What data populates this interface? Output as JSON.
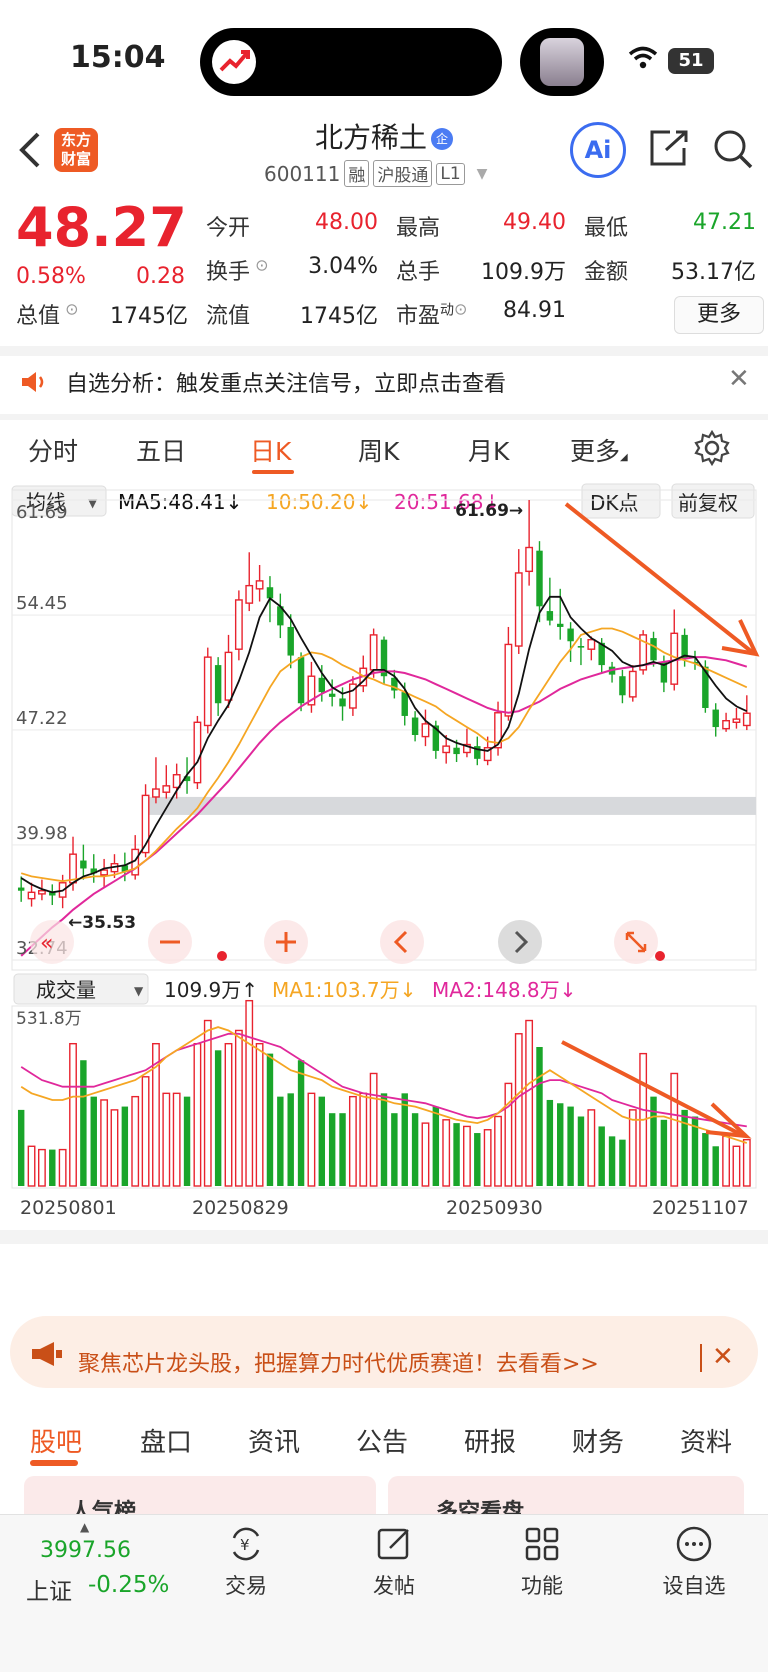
{
  "status": {
    "time": "15:04",
    "battery": "51"
  },
  "header": {
    "logo": "东方财富",
    "title": "北方稀土",
    "title_badge": "企",
    "code": "600111",
    "tags": [
      "融",
      "沪股通",
      "L1"
    ],
    "ai": "Ai"
  },
  "quote": {
    "price": "48.27",
    "change_pct": "0.58%",
    "change": "0.28",
    "fields": [
      {
        "label": "今开",
        "value": "48.00",
        "color": "red"
      },
      {
        "label": "最高",
        "value": "49.40",
        "color": "red"
      },
      {
        "label": "最低",
        "value": "47.21",
        "color": "green"
      },
      {
        "label": "换手",
        "value": "3.04%",
        "color": "dark"
      },
      {
        "label": "总手",
        "value": "109.9万",
        "color": "dark"
      },
      {
        "label": "金额",
        "value": "53.17亿",
        "color": "dark"
      },
      {
        "label": "总值",
        "value": "1745亿",
        "color": "dark"
      },
      {
        "label": "流值",
        "value": "1745亿",
        "color": "dark"
      },
      {
        "label": "市盈",
        "value": "84.91",
        "color": "dark"
      }
    ],
    "pe_sup": "动",
    "more": "更多"
  },
  "notice": {
    "text": "自选分析：触发重点关注信号，立即点击查看"
  },
  "chart_tabs": [
    "分时",
    "五日",
    "日K",
    "周K",
    "月K",
    "更多"
  ],
  "chart_tabs_active": 2,
  "kline": {
    "indicator_select": "均线",
    "ma5": "MA5:48.41↓",
    "ma10": "10:50.20↓",
    "ma20": "20:51.68↓",
    "dk_label": "DK点",
    "fq_label": "前复权",
    "y_labels": [
      "61.69",
      "54.45",
      "47.22",
      "39.98",
      "32.74"
    ],
    "high_marker": "61.69→",
    "low_marker": "←35.53"
  },
  "volume": {
    "select": "成交量",
    "value": "109.9万↑",
    "ma1": "MA1:103.7万↓",
    "ma2": "MA2:148.8万↓",
    "y_top": "531.8万",
    "dates": [
      "20250801",
      "20250829",
      "20250930",
      "20251107"
    ]
  },
  "chart_data": {
    "type": "candlestick",
    "y_range": [
      32.74,
      61.69
    ],
    "candles": [
      [
        37.3,
        37.1,
        38.0,
        36.4
      ],
      [
        36.6,
        37.0,
        37.6,
        36.1
      ],
      [
        36.9,
        37.1,
        37.8,
        36.5
      ],
      [
        37.0,
        36.8,
        37.5,
        36.2
      ],
      [
        36.7,
        37.6,
        38.1,
        36.0
      ],
      [
        37.6,
        39.4,
        40.5,
        37.1
      ],
      [
        39.0,
        38.5,
        40.0,
        37.8
      ],
      [
        38.5,
        38.2,
        39.4,
        37.6
      ],
      [
        38.1,
        38.4,
        39.1,
        37.3
      ],
      [
        38.3,
        38.8,
        39.4,
        37.9
      ],
      [
        38.7,
        38.3,
        39.5,
        37.7
      ],
      [
        38.1,
        39.7,
        40.6,
        37.8
      ],
      [
        39.5,
        43.1,
        43.8,
        39.2
      ],
      [
        43.0,
        43.5,
        45.5,
        42.6
      ],
      [
        43.3,
        43.7,
        45.0,
        42.9
      ],
      [
        43.6,
        44.4,
        45.1,
        42.9
      ],
      [
        44.3,
        44.0,
        45.5,
        43.2
      ],
      [
        43.9,
        47.7,
        48.1,
        43.5
      ],
      [
        47.5,
        51.8,
        52.4,
        47.0
      ],
      [
        51.3,
        48.9,
        51.8,
        48.1
      ],
      [
        49.1,
        52.1,
        53.2,
        48.6
      ],
      [
        52.3,
        55.4,
        56.0,
        51.6
      ],
      [
        55.2,
        56.3,
        58.4,
        54.7
      ],
      [
        56.1,
        56.6,
        57.6,
        55.3
      ],
      [
        56.2,
        55.5,
        56.9,
        54.0
      ],
      [
        55.0,
        53.8,
        55.8,
        53.0
      ],
      [
        53.7,
        51.9,
        54.5,
        51.1
      ],
      [
        51.8,
        48.9,
        52.1,
        48.4
      ],
      [
        48.8,
        50.6,
        51.5,
        48.3
      ],
      [
        50.5,
        49.6,
        51.3,
        49.0
      ],
      [
        49.5,
        49.3,
        50.4,
        48.7
      ],
      [
        49.2,
        48.7,
        49.9,
        47.8
      ],
      [
        48.6,
        50.1,
        50.6,
        48.1
      ],
      [
        50.0,
        51.1,
        51.9,
        49.6
      ],
      [
        51.0,
        53.2,
        53.6,
        50.5
      ],
      [
        52.9,
        50.6,
        53.1,
        50.1
      ],
      [
        50.5,
        49.7,
        51.0,
        49.2
      ],
      [
        49.6,
        48.1,
        50.2,
        47.5
      ],
      [
        48.0,
        46.9,
        48.4,
        46.5
      ],
      [
        46.8,
        47.6,
        48.5,
        46.2
      ],
      [
        47.5,
        45.9,
        47.8,
        45.4
      ],
      [
        45.8,
        46.2,
        46.9,
        45.1
      ],
      [
        46.1,
        45.7,
        46.6,
        45.2
      ],
      [
        45.8,
        46.3,
        47.3,
        45.5
      ],
      [
        46.2,
        45.4,
        46.8,
        45.0
      ],
      [
        45.3,
        46.1,
        46.8,
        45.0
      ],
      [
        46.1,
        48.3,
        49.0,
        45.6
      ],
      [
        48.1,
        52.6,
        53.7,
        47.8
      ],
      [
        52.5,
        57.1,
        58.6,
        52.0
      ],
      [
        57.2,
        58.7,
        61.69,
        56.3
      ],
      [
        58.5,
        55.0,
        59.1,
        54.0
      ],
      [
        54.7,
        54.1,
        56.8,
        53.8
      ],
      [
        53.9,
        53.7,
        56.1,
        52.9
      ],
      [
        53.6,
        52.8,
        54.0,
        51.5
      ],
      [
        52.5,
        52.4,
        53.0,
        51.3
      ],
      [
        52.3,
        52.9,
        53.1,
        51.6
      ],
      [
        52.7,
        51.3,
        53.0,
        50.8
      ],
      [
        51.2,
        50.7,
        51.5,
        50.2
      ],
      [
        50.6,
        49.4,
        51.0,
        48.9
      ],
      [
        49.3,
        50.9,
        51.3,
        49.0
      ],
      [
        51.0,
        53.2,
        53.5,
        50.7
      ],
      [
        53.0,
        51.6,
        53.4,
        51.2
      ],
      [
        51.5,
        50.2,
        51.9,
        49.6
      ],
      [
        50.1,
        53.3,
        54.8,
        49.7
      ],
      [
        53.2,
        51.7,
        53.6,
        51.2
      ],
      [
        51.5,
        51.4,
        52.2,
        51.0
      ],
      [
        51.2,
        48.6,
        51.6,
        48.3
      ],
      [
        48.5,
        47.4,
        48.9,
        46.8
      ],
      [
        47.3,
        47.8,
        48.3,
        47.1
      ],
      [
        47.7,
        47.9,
        48.6,
        47.3
      ],
      [
        47.5,
        48.27,
        49.4,
        47.21
      ]
    ],
    "ma_black": [
      37.9,
      37.5,
      37.2,
      37.0,
      37.1,
      37.6,
      38.0,
      38.2,
      38.5,
      38.6,
      38.7,
      39.0,
      40.0,
      41.2,
      42.3,
      43.4,
      44.4,
      45.2,
      46.7,
      47.8,
      48.8,
      50.3,
      52.1,
      54.3,
      55.5,
      55.0,
      54.2,
      53.0,
      51.9,
      50.8,
      49.9,
      49.5,
      49.7,
      50.3,
      51.0,
      51.0,
      50.6,
      49.8,
      48.6,
      47.8,
      47.3,
      46.7,
      46.4,
      46.2,
      46.0,
      45.9,
      46.3,
      47.4,
      49.5,
      52.3,
      54.6,
      55.6,
      55.6,
      54.3,
      53.6,
      53.0,
      52.6,
      52.2,
      51.5,
      51.2,
      51.3,
      51.5,
      51.3,
      51.6,
      51.9,
      51.8,
      50.9,
      50.0,
      49.2,
      48.7,
      48.4
    ],
    "ma_orange": [
      38.2,
      38.0,
      37.9,
      37.8,
      37.7,
      37.8,
      37.9,
      38.0,
      38.0,
      38.1,
      38.3,
      38.5,
      39.0,
      39.6,
      40.3,
      41.0,
      41.6,
      42.3,
      43.3,
      44.2,
      45.2,
      46.3,
      47.5,
      48.7,
      49.9,
      50.9,
      51.4,
      51.8,
      52.1,
      52.0,
      51.7,
      51.3,
      51.0,
      50.6,
      50.4,
      50.1,
      49.9,
      49.6,
      49.3,
      49.0,
      48.7,
      48.2,
      47.8,
      47.4,
      47.0,
      46.5,
      46.4,
      46.7,
      47.4,
      48.5,
      49.5,
      50.5,
      51.5,
      52.3,
      53.2,
      53.4,
      53.6,
      53.6,
      53.4,
      53.1,
      52.8,
      52.5,
      52.1,
      51.8,
      51.6,
      51.4,
      51.1,
      50.8,
      50.5,
      50.2,
      49.9
    ],
    "ma_magenta": [
      33.0,
      33.6,
      34.2,
      34.8,
      35.3,
      35.9,
      36.4,
      36.9,
      37.3,
      37.7,
      38.1,
      38.5,
      39.0,
      39.5,
      40.1,
      40.7,
      41.3,
      41.9,
      42.6,
      43.3,
      44.0,
      44.8,
      45.6,
      46.4,
      47.1,
      47.7,
      48.2,
      48.7,
      49.1,
      49.5,
      49.8,
      50.1,
      50.4,
      50.6,
      50.8,
      50.9,
      50.9,
      50.8,
      50.6,
      50.4,
      50.1,
      49.8,
      49.5,
      49.2,
      48.9,
      48.6,
      48.4,
      48.3,
      48.4,
      48.7,
      49.0,
      49.4,
      49.8,
      50.1,
      50.4,
      50.6,
      50.8,
      51.0,
      51.1,
      51.2,
      51.3,
      51.4,
      51.5,
      51.6,
      51.7,
      51.8,
      51.8,
      51.7,
      51.6,
      51.4,
      51.2
    ],
    "gray_band": 42.5,
    "volume": {
      "max": 531.8,
      "values": [
        230,
        120,
        110,
        110,
        110,
        430,
        380,
        270,
        260,
        230,
        240,
        270,
        330,
        430,
        280,
        280,
        270,
        430,
        500,
        410,
        430,
        470,
        560,
        430,
        400,
        270,
        280,
        380,
        280,
        270,
        220,
        220,
        270,
        280,
        340,
        280,
        220,
        280,
        220,
        190,
        240,
        200,
        190,
        180,
        160,
        170,
        210,
        310,
        460,
        500,
        420,
        260,
        250,
        240,
        210,
        230,
        180,
        150,
        140,
        230,
        400,
        270,
        200,
        340,
        230,
        210,
        160,
        120,
        150,
        120,
        140
      ],
      "ma1": [
        300,
        280,
        270,
        260,
        260,
        270,
        270,
        280,
        290,
        300,
        310,
        320,
        340,
        360,
        390,
        410,
        430,
        450,
        470,
        480,
        470,
        450,
        430,
        410,
        390,
        370,
        350,
        340,
        330,
        320,
        300,
        290,
        280,
        270,
        265,
        260,
        250,
        245,
        240,
        230,
        220,
        210,
        200,
        195,
        190,
        200,
        220,
        250,
        280,
        310,
        330,
        350,
        330,
        310,
        290,
        270,
        250,
        230,
        210,
        200,
        200,
        210,
        210,
        200,
        190,
        180,
        170,
        160,
        150,
        140,
        130
      ],
      "ma2": [
        360,
        340,
        320,
        310,
        300,
        300,
        300,
        300,
        310,
        320,
        330,
        340,
        350,
        370,
        390,
        410,
        420,
        430,
        440,
        450,
        460,
        460,
        450,
        440,
        430,
        420,
        400,
        380,
        360,
        340,
        320,
        300,
        290,
        280,
        275,
        270,
        265,
        260,
        255,
        250,
        240,
        230,
        220,
        210,
        205,
        210,
        220,
        240,
        270,
        290,
        310,
        320,
        320,
        310,
        300,
        290,
        280,
        260,
        250,
        240,
        230,
        225,
        220,
        215,
        210,
        205,
        200,
        195,
        190,
        185,
        180
      ]
    }
  },
  "banner": {
    "text": "聚焦芯片龙头股，把握算力时代优质赛道！去看看>>"
  },
  "bottom_tabs": [
    "股吧",
    "盘口",
    "资讯",
    "公告",
    "研报",
    "财务",
    "资料"
  ],
  "peek": [
    "人气榜",
    "多空看盘"
  ],
  "bottom_nav": {
    "index_value": "3997.56",
    "index_name": "上证",
    "index_pct": "-0.25%",
    "items": [
      "交易",
      "发帖",
      "功能",
      "设自选"
    ]
  },
  "colors": {
    "up": "#e8232e",
    "down": "#1aa52a",
    "accent": "#ee5a24",
    "ma5": "#111111",
    "ma10": "#f5a623",
    "ma20": "#e0289b",
    "arrow": "#ee5a24"
  }
}
